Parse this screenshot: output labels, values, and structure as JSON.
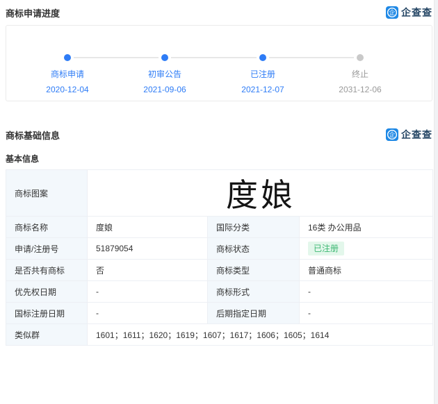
{
  "brand": {
    "icon_glyph": "企",
    "name": "企查查"
  },
  "progress": {
    "title": "商标申请进度",
    "steps": [
      {
        "label": "商标申请",
        "date": "2020-12-04",
        "state": "active"
      },
      {
        "label": "初审公告",
        "date": "2021-09-06",
        "state": "active"
      },
      {
        "label": "已注册",
        "date": "2021-12-07",
        "state": "active"
      },
      {
        "label": "终止",
        "date": "2031-12-06",
        "state": "inactive"
      }
    ]
  },
  "basic": {
    "title": "商标基础信息",
    "subtitle": "基本信息",
    "image_row": {
      "label": "商标图案",
      "image_text": "度娘"
    },
    "rows": [
      [
        {
          "label": "商标名称",
          "value": "度娘"
        },
        {
          "label": "国际分类",
          "value": "16类 办公用品"
        }
      ],
      [
        {
          "label": "申请/注册号",
          "value": "51879054"
        },
        {
          "label": "商标状态",
          "value": "已注册"
        }
      ],
      [
        {
          "label": "是否共有商标",
          "value": "否"
        },
        {
          "label": "商标类型",
          "value": "普通商标"
        }
      ],
      [
        {
          "label": "优先权日期",
          "value": "-"
        },
        {
          "label": "商标形式",
          "value": "-"
        }
      ],
      [
        {
          "label": "国标注册日期",
          "value": "-"
        },
        {
          "label": "后期指定日期",
          "value": "-"
        }
      ]
    ],
    "full_row": {
      "label": "类似群",
      "value": "1601；1611；1620；1619；1607；1617；1606；1605；1614"
    }
  },
  "colors": {
    "accent_blue": "#2e7cf6",
    "inactive_gray": "#999999",
    "badge_bg": "#e3f7eb",
    "badge_text": "#3db873",
    "label_cell_bg": "#f3f8fc",
    "brand_blue": "#1e88e5"
  }
}
